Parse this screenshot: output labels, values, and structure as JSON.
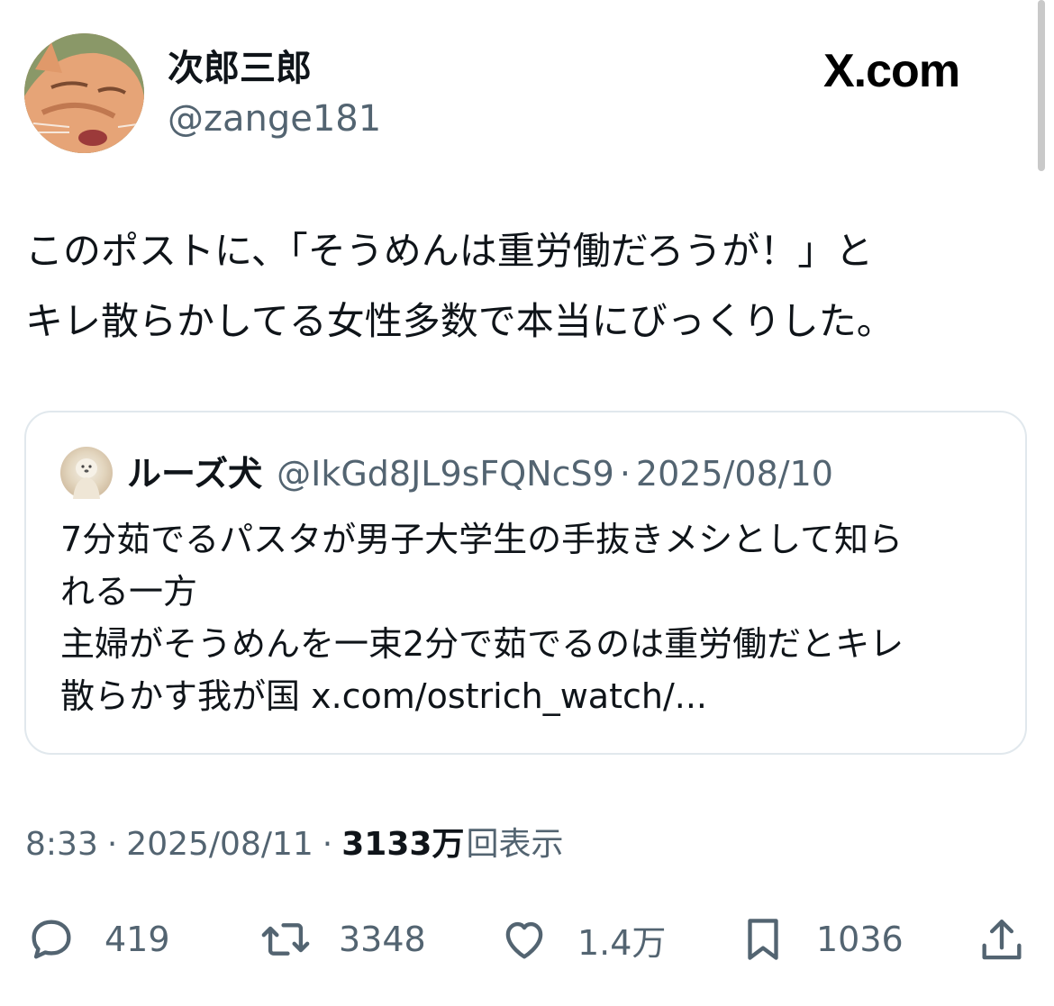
{
  "author": {
    "display_name": "次郎三郎",
    "handle": "@zange181"
  },
  "brand": {
    "label": "X.com"
  },
  "post": {
    "lines": [
      "このポストに、「そうめんは重労働だろうが！」と",
      "キレ散らかしてる女性多数で本当にびっくりした。"
    ]
  },
  "quoted": {
    "display_name": "ルーズ犬",
    "handle": "@IkGd8JL9sFQNcS9",
    "separator": "·",
    "date": "2025/08/10",
    "lines": [
      "7分茹でるパスタが男子大学生の手抜きメシとして知ら",
      "れる一方",
      "主婦がそうめんを一束2分で茹でるのは重労働だとキレ",
      "散らかす我が国 x.com/ostrich_watch/..."
    ]
  },
  "meta": {
    "time": "8:33",
    "separator": "·",
    "date": "2025/08/11",
    "views_count": "3133",
    "views_unit": "万",
    "views_label": "回表示"
  },
  "actions": {
    "replies": "419",
    "reposts": "3348",
    "likes": "1.4万",
    "bookmarks": "1036"
  },
  "icons": {
    "reply": "reply-icon",
    "repost": "repost-icon",
    "like": "heart-icon",
    "bookmark": "bookmark-icon",
    "share": "share-icon"
  },
  "colors": {
    "text": "#0f1419",
    "secondary": "#536471",
    "border": "#e1e8ed"
  }
}
